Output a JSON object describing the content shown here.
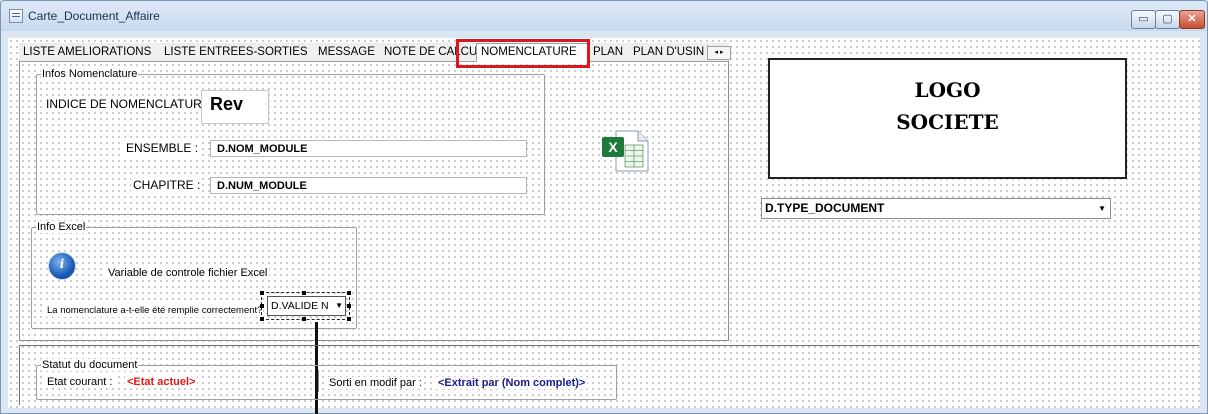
{
  "window": {
    "title": "Carte_Document_Affaire"
  },
  "window_buttons": {
    "minimize": "▭",
    "maximize": "▢",
    "close": "✕"
  },
  "tabs": [
    {
      "label": "LISTE AMELIORATIONS"
    },
    {
      "label": "LISTE ENTREES-SORTIES"
    },
    {
      "label": "MESSAGE"
    },
    {
      "label": "NOTE DE CALCUL"
    },
    {
      "label": "NOMENCLATURE"
    },
    {
      "label": "PLAN"
    },
    {
      "label": "PLAN D'USIN"
    }
  ],
  "tab_scroll": "◂ ▸",
  "nomenclature": {
    "legend": "Infos Nomenclature",
    "indice_label": "INDICE DE NOMENCLATURE :",
    "indice_value": "Rev",
    "ensemble_label": "ENSEMBLE :",
    "ensemble_value": "D.NOM_MODULE",
    "chapitre_label": "CHAPITRE :",
    "chapitre_value": "D.NUM_MODULE"
  },
  "excel": {
    "legend": "Info Excel",
    "variable_label": "Variable de controle fichier Excel",
    "question_label": "La nomenclature a-t-elle été remplie correctement?",
    "combo_value": "D.VALIDE N"
  },
  "logo": {
    "line1": "LOGO",
    "line2": "SOCIETE"
  },
  "type_document": "D.TYPE_DOCUMENT",
  "statut": {
    "legend": "Statut du document",
    "etat_label": "Etat courant :",
    "etat_value": "<Etat actuel>",
    "sorti_label": "Sorti en modif par :",
    "sorti_value": "<Extrait par (Nom complet)>"
  }
}
